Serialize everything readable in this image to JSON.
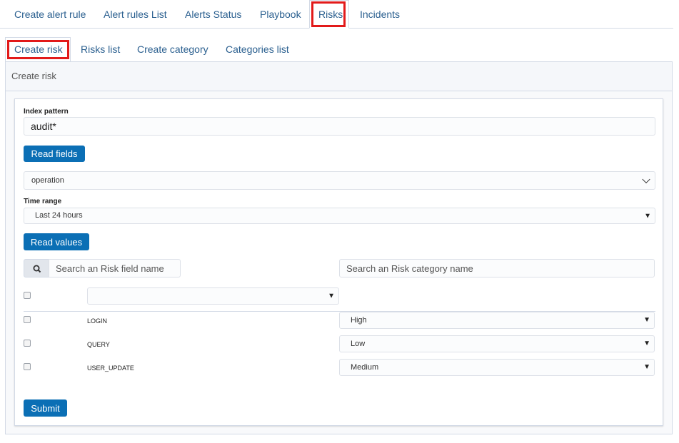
{
  "tabs": [
    {
      "label": "Create alert rule"
    },
    {
      "label": "Alert rules List"
    },
    {
      "label": "Alerts Status"
    },
    {
      "label": "Playbook"
    },
    {
      "label": "Risks"
    },
    {
      "label": "Incidents"
    }
  ],
  "subtabs": [
    {
      "label": "Create risk"
    },
    {
      "label": "Risks list"
    },
    {
      "label": "Create category"
    },
    {
      "label": "Categories list"
    }
  ],
  "panel": {
    "title": "Create risk"
  },
  "form": {
    "index_pattern_label": "Index pattern",
    "index_pattern_value": "audit*",
    "read_fields_label": "Read fields",
    "field_select_value": "operation",
    "time_range_label": "Time range",
    "time_range_value": "Last 24 hours",
    "read_values_label": "Read values",
    "search_field_placeholder": "Search an Risk field name",
    "search_category_placeholder": "Search an Risk category name",
    "submit_label": "Submit"
  },
  "rows": [
    {
      "name": "LOGIN",
      "risk": "High"
    },
    {
      "name": "QUERY",
      "risk": "Low"
    },
    {
      "name": "USER_UPDATE",
      "risk": "Medium"
    }
  ],
  "colors": {
    "accent": "#0b6fb5",
    "highlight": "#e21a1a",
    "link": "#2a5f8f"
  }
}
